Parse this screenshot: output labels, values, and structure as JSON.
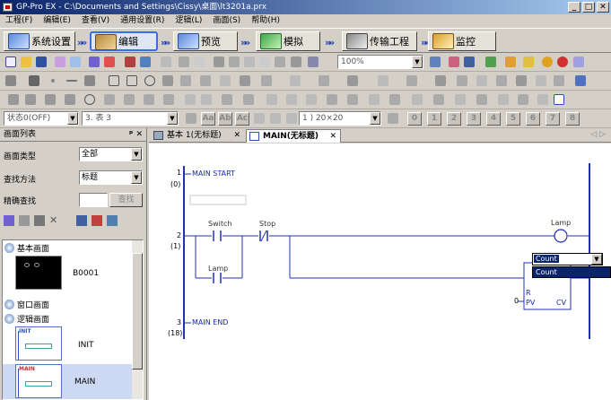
{
  "window": {
    "title": "GP-Pro EX - C:\\Documents and Settings\\Cissy\\桌面\\lt3201a.prx"
  },
  "menu": [
    "工程(F)",
    "编辑(E)",
    "查看(V)",
    "通用设置(R)",
    "逻辑(L)",
    "画面(S)",
    "帮助(H)"
  ],
  "wizard": {
    "steps": [
      "系统设置",
      "编辑",
      "预览",
      "模拟",
      "传输工程",
      "监控"
    ],
    "active": "编辑"
  },
  "toolbar": {
    "zoom": "100%",
    "state": "状态0(OFF)",
    "table": "3. 表 3",
    "grid": "1 ) 20×20",
    "num_buttons": [
      "0",
      "1",
      "2",
      "3",
      "4",
      "5",
      "6",
      "7",
      "8"
    ],
    "text_buttons": [
      "Aa",
      "Ab",
      "Ac"
    ]
  },
  "left_panel": {
    "title": "画面列表",
    "pin": "ᵖ ✕",
    "screen_type_label": "画面类型",
    "screen_type_value": "全部",
    "search_method_label": "查找方法",
    "search_method_value": "标题",
    "exact_search_label": "精确查找",
    "search_button": "查找",
    "groups": {
      "base": "基本画面",
      "window": "窗口画面",
      "logic": "逻辑画面"
    },
    "items": {
      "b0001": "B0001",
      "init": "INIT",
      "main": "MAIN"
    },
    "thumb_labels": {
      "init": "INIT",
      "main": "MAIN"
    }
  },
  "tabs": [
    {
      "label": "基本 1(无标题)",
      "close": "✕"
    },
    {
      "label": "MAIN(无标题)",
      "close": "✕"
    }
  ],
  "tab_nav": "◁ ▷",
  "ladder": {
    "rung1_num": "1",
    "rung1_step": "(0)",
    "main_start": "MAIN START",
    "rung2_num": "2",
    "rung2_step": "(1)",
    "switch": "Switch",
    "stop": "Stop",
    "lamp_coil": "Lamp",
    "lamp_contact": "Lamp",
    "counter_dropdown": "Count",
    "counter_dropdown_option": "Count",
    "counter_R": "R",
    "counter_PV": "PV",
    "counter_CV": "CV",
    "counter_zero": "0",
    "rung3_num": "3",
    "rung3_step": "(18)",
    "main_end": "MAIN END"
  }
}
